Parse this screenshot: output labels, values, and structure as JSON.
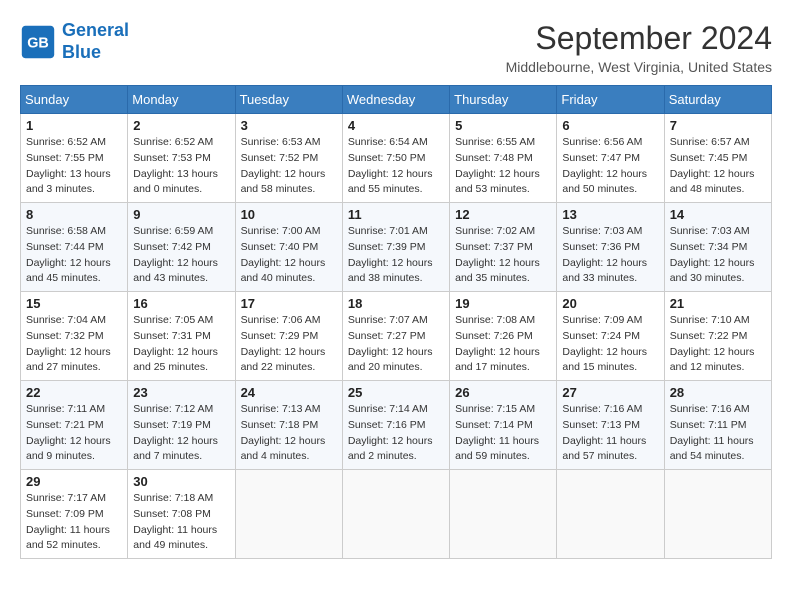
{
  "header": {
    "logo_line1": "General",
    "logo_line2": "Blue",
    "month": "September 2024",
    "location": "Middlebourne, West Virginia, United States"
  },
  "weekdays": [
    "Sunday",
    "Monday",
    "Tuesday",
    "Wednesday",
    "Thursday",
    "Friday",
    "Saturday"
  ],
  "weeks": [
    [
      {
        "day": "1",
        "sunrise": "6:52 AM",
        "sunset": "7:55 PM",
        "daylight": "13 hours and 3 minutes."
      },
      {
        "day": "2",
        "sunrise": "6:52 AM",
        "sunset": "7:53 PM",
        "daylight": "13 hours and 0 minutes."
      },
      {
        "day": "3",
        "sunrise": "6:53 AM",
        "sunset": "7:52 PM",
        "daylight": "12 hours and 58 minutes."
      },
      {
        "day": "4",
        "sunrise": "6:54 AM",
        "sunset": "7:50 PM",
        "daylight": "12 hours and 55 minutes."
      },
      {
        "day": "5",
        "sunrise": "6:55 AM",
        "sunset": "7:48 PM",
        "daylight": "12 hours and 53 minutes."
      },
      {
        "day": "6",
        "sunrise": "6:56 AM",
        "sunset": "7:47 PM",
        "daylight": "12 hours and 50 minutes."
      },
      {
        "day": "7",
        "sunrise": "6:57 AM",
        "sunset": "7:45 PM",
        "daylight": "12 hours and 48 minutes."
      }
    ],
    [
      {
        "day": "8",
        "sunrise": "6:58 AM",
        "sunset": "7:44 PM",
        "daylight": "12 hours and 45 minutes."
      },
      {
        "day": "9",
        "sunrise": "6:59 AM",
        "sunset": "7:42 PM",
        "daylight": "12 hours and 43 minutes."
      },
      {
        "day": "10",
        "sunrise": "7:00 AM",
        "sunset": "7:40 PM",
        "daylight": "12 hours and 40 minutes."
      },
      {
        "day": "11",
        "sunrise": "7:01 AM",
        "sunset": "7:39 PM",
        "daylight": "12 hours and 38 minutes."
      },
      {
        "day": "12",
        "sunrise": "7:02 AM",
        "sunset": "7:37 PM",
        "daylight": "12 hours and 35 minutes."
      },
      {
        "day": "13",
        "sunrise": "7:03 AM",
        "sunset": "7:36 PM",
        "daylight": "12 hours and 33 minutes."
      },
      {
        "day": "14",
        "sunrise": "7:03 AM",
        "sunset": "7:34 PM",
        "daylight": "12 hours and 30 minutes."
      }
    ],
    [
      {
        "day": "15",
        "sunrise": "7:04 AM",
        "sunset": "7:32 PM",
        "daylight": "12 hours and 27 minutes."
      },
      {
        "day": "16",
        "sunrise": "7:05 AM",
        "sunset": "7:31 PM",
        "daylight": "12 hours and 25 minutes."
      },
      {
        "day": "17",
        "sunrise": "7:06 AM",
        "sunset": "7:29 PM",
        "daylight": "12 hours and 22 minutes."
      },
      {
        "day": "18",
        "sunrise": "7:07 AM",
        "sunset": "7:27 PM",
        "daylight": "12 hours and 20 minutes."
      },
      {
        "day": "19",
        "sunrise": "7:08 AM",
        "sunset": "7:26 PM",
        "daylight": "12 hours and 17 minutes."
      },
      {
        "day": "20",
        "sunrise": "7:09 AM",
        "sunset": "7:24 PM",
        "daylight": "12 hours and 15 minutes."
      },
      {
        "day": "21",
        "sunrise": "7:10 AM",
        "sunset": "7:22 PM",
        "daylight": "12 hours and 12 minutes."
      }
    ],
    [
      {
        "day": "22",
        "sunrise": "7:11 AM",
        "sunset": "7:21 PM",
        "daylight": "12 hours and 9 minutes."
      },
      {
        "day": "23",
        "sunrise": "7:12 AM",
        "sunset": "7:19 PM",
        "daylight": "12 hours and 7 minutes."
      },
      {
        "day": "24",
        "sunrise": "7:13 AM",
        "sunset": "7:18 PM",
        "daylight": "12 hours and 4 minutes."
      },
      {
        "day": "25",
        "sunrise": "7:14 AM",
        "sunset": "7:16 PM",
        "daylight": "12 hours and 2 minutes."
      },
      {
        "day": "26",
        "sunrise": "7:15 AM",
        "sunset": "7:14 PM",
        "daylight": "11 hours and 59 minutes."
      },
      {
        "day": "27",
        "sunrise": "7:16 AM",
        "sunset": "7:13 PM",
        "daylight": "11 hours and 57 minutes."
      },
      {
        "day": "28",
        "sunrise": "7:16 AM",
        "sunset": "7:11 PM",
        "daylight": "11 hours and 54 minutes."
      }
    ],
    [
      {
        "day": "29",
        "sunrise": "7:17 AM",
        "sunset": "7:09 PM",
        "daylight": "11 hours and 52 minutes."
      },
      {
        "day": "30",
        "sunrise": "7:18 AM",
        "sunset": "7:08 PM",
        "daylight": "11 hours and 49 minutes."
      },
      null,
      null,
      null,
      null,
      null
    ]
  ]
}
